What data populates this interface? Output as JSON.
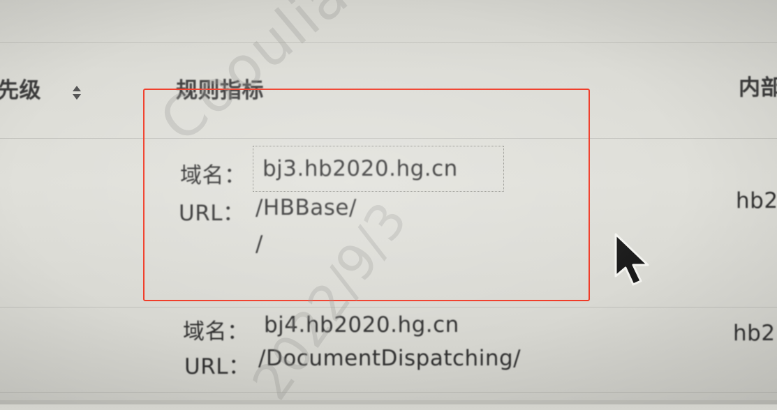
{
  "table": {
    "headers": {
      "priority": "先级",
      "rule_indicator": "规则指标",
      "content_partial": "内部"
    },
    "rows": [
      {
        "domain_label": "域名：",
        "domain_value": "bj3.hb2020.hg.cn",
        "url_label": "URL：",
        "url_value": "/HBBase/",
        "url_value_2": "/",
        "content_partial": "hb2"
      },
      {
        "domain_label": "域名：",
        "domain_value": "bj4.hb2020.hg.cn",
        "url_label": "URL：",
        "url_value": "/DocumentDispatching/",
        "content_partial": "hb2"
      }
    ]
  },
  "watermark": {
    "text": "Cooulianchen",
    "date": "2022/9/3"
  },
  "colors": {
    "highlight": "#f03a26",
    "screen_bg": "#dcdcd6"
  },
  "icons": {
    "sort": "sort-icon",
    "cursor": "mouse-pointer-icon"
  }
}
